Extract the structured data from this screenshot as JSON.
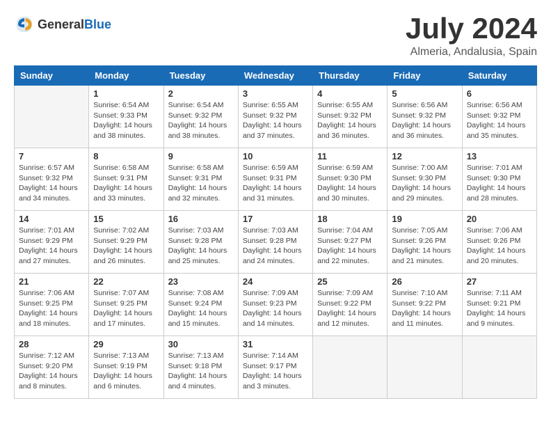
{
  "header": {
    "logo_general": "General",
    "logo_blue": "Blue",
    "month_title": "July 2024",
    "location": "Almeria, Andalusia, Spain"
  },
  "calendar": {
    "days_of_week": [
      "Sunday",
      "Monday",
      "Tuesday",
      "Wednesday",
      "Thursday",
      "Friday",
      "Saturday"
    ],
    "weeks": [
      [
        {
          "day": "",
          "info": ""
        },
        {
          "day": "1",
          "info": "Sunrise: 6:54 AM\nSunset: 9:33 PM\nDaylight: 14 hours\nand 38 minutes."
        },
        {
          "day": "2",
          "info": "Sunrise: 6:54 AM\nSunset: 9:32 PM\nDaylight: 14 hours\nand 38 minutes."
        },
        {
          "day": "3",
          "info": "Sunrise: 6:55 AM\nSunset: 9:32 PM\nDaylight: 14 hours\nand 37 minutes."
        },
        {
          "day": "4",
          "info": "Sunrise: 6:55 AM\nSunset: 9:32 PM\nDaylight: 14 hours\nand 36 minutes."
        },
        {
          "day": "5",
          "info": "Sunrise: 6:56 AM\nSunset: 9:32 PM\nDaylight: 14 hours\nand 36 minutes."
        },
        {
          "day": "6",
          "info": "Sunrise: 6:56 AM\nSunset: 9:32 PM\nDaylight: 14 hours\nand 35 minutes."
        }
      ],
      [
        {
          "day": "7",
          "info": "Sunrise: 6:57 AM\nSunset: 9:32 PM\nDaylight: 14 hours\nand 34 minutes."
        },
        {
          "day": "8",
          "info": "Sunrise: 6:58 AM\nSunset: 9:31 PM\nDaylight: 14 hours\nand 33 minutes."
        },
        {
          "day": "9",
          "info": "Sunrise: 6:58 AM\nSunset: 9:31 PM\nDaylight: 14 hours\nand 32 minutes."
        },
        {
          "day": "10",
          "info": "Sunrise: 6:59 AM\nSunset: 9:31 PM\nDaylight: 14 hours\nand 31 minutes."
        },
        {
          "day": "11",
          "info": "Sunrise: 6:59 AM\nSunset: 9:30 PM\nDaylight: 14 hours\nand 30 minutes."
        },
        {
          "day": "12",
          "info": "Sunrise: 7:00 AM\nSunset: 9:30 PM\nDaylight: 14 hours\nand 29 minutes."
        },
        {
          "day": "13",
          "info": "Sunrise: 7:01 AM\nSunset: 9:30 PM\nDaylight: 14 hours\nand 28 minutes."
        }
      ],
      [
        {
          "day": "14",
          "info": "Sunrise: 7:01 AM\nSunset: 9:29 PM\nDaylight: 14 hours\nand 27 minutes."
        },
        {
          "day": "15",
          "info": "Sunrise: 7:02 AM\nSunset: 9:29 PM\nDaylight: 14 hours\nand 26 minutes."
        },
        {
          "day": "16",
          "info": "Sunrise: 7:03 AM\nSunset: 9:28 PM\nDaylight: 14 hours\nand 25 minutes."
        },
        {
          "day": "17",
          "info": "Sunrise: 7:03 AM\nSunset: 9:28 PM\nDaylight: 14 hours\nand 24 minutes."
        },
        {
          "day": "18",
          "info": "Sunrise: 7:04 AM\nSunset: 9:27 PM\nDaylight: 14 hours\nand 22 minutes."
        },
        {
          "day": "19",
          "info": "Sunrise: 7:05 AM\nSunset: 9:26 PM\nDaylight: 14 hours\nand 21 minutes."
        },
        {
          "day": "20",
          "info": "Sunrise: 7:06 AM\nSunset: 9:26 PM\nDaylight: 14 hours\nand 20 minutes."
        }
      ],
      [
        {
          "day": "21",
          "info": "Sunrise: 7:06 AM\nSunset: 9:25 PM\nDaylight: 14 hours\nand 18 minutes."
        },
        {
          "day": "22",
          "info": "Sunrise: 7:07 AM\nSunset: 9:25 PM\nDaylight: 14 hours\nand 17 minutes."
        },
        {
          "day": "23",
          "info": "Sunrise: 7:08 AM\nSunset: 9:24 PM\nDaylight: 14 hours\nand 15 minutes."
        },
        {
          "day": "24",
          "info": "Sunrise: 7:09 AM\nSunset: 9:23 PM\nDaylight: 14 hours\nand 14 minutes."
        },
        {
          "day": "25",
          "info": "Sunrise: 7:09 AM\nSunset: 9:22 PM\nDaylight: 14 hours\nand 12 minutes."
        },
        {
          "day": "26",
          "info": "Sunrise: 7:10 AM\nSunset: 9:22 PM\nDaylight: 14 hours\nand 11 minutes."
        },
        {
          "day": "27",
          "info": "Sunrise: 7:11 AM\nSunset: 9:21 PM\nDaylight: 14 hours\nand 9 minutes."
        }
      ],
      [
        {
          "day": "28",
          "info": "Sunrise: 7:12 AM\nSunset: 9:20 PM\nDaylight: 14 hours\nand 8 minutes."
        },
        {
          "day": "29",
          "info": "Sunrise: 7:13 AM\nSunset: 9:19 PM\nDaylight: 14 hours\nand 6 minutes."
        },
        {
          "day": "30",
          "info": "Sunrise: 7:13 AM\nSunset: 9:18 PM\nDaylight: 14 hours\nand 4 minutes."
        },
        {
          "day": "31",
          "info": "Sunrise: 7:14 AM\nSunset: 9:17 PM\nDaylight: 14 hours\nand 3 minutes."
        },
        {
          "day": "",
          "info": ""
        },
        {
          "day": "",
          "info": ""
        },
        {
          "day": "",
          "info": ""
        }
      ]
    ]
  }
}
